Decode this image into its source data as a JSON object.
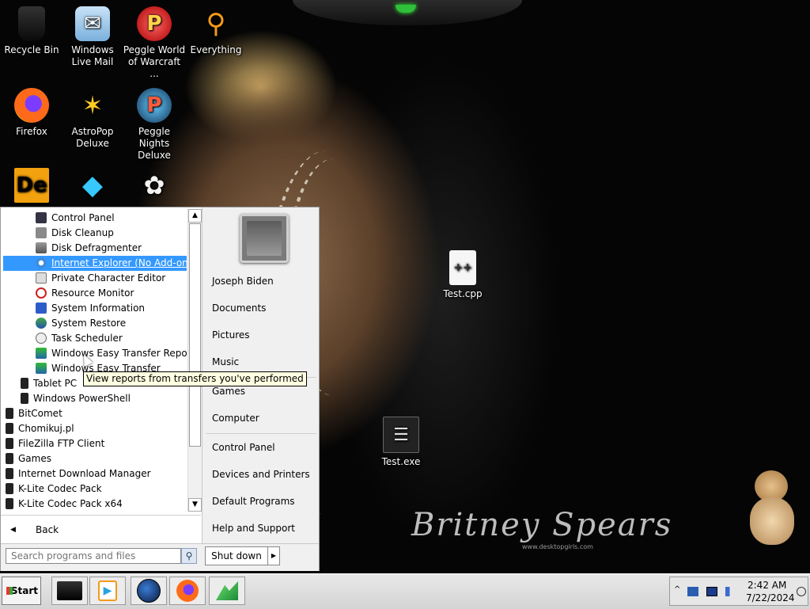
{
  "desktop": {
    "icons": [
      {
        "label": "Recycle Bin"
      },
      {
        "label": "Windows Live Mail"
      },
      {
        "label": "Peggle World of Warcraft ..."
      },
      {
        "label": "Everything"
      },
      {
        "label": "Firefox"
      },
      {
        "label": "AstroPop Deluxe"
      },
      {
        "label": "Peggle Nights Deluxe"
      },
      {
        "label": "Test.cpp"
      },
      {
        "label": "Test.exe"
      }
    ],
    "signature": "Britney Spears",
    "signature_sub": "www.desktopgirls.com"
  },
  "start_menu": {
    "programs": [
      {
        "label": "Control Panel",
        "icon": "monitor-icon"
      },
      {
        "label": "Disk Cleanup",
        "icon": "disk-cleanup-icon"
      },
      {
        "label": "Disk Defragmenter",
        "icon": "defrag-icon"
      },
      {
        "label": "Internet Explorer (No Add-ons)",
        "icon": "ie-icon",
        "selected": true
      },
      {
        "label": "Private Character Editor",
        "icon": "pencil-icon"
      },
      {
        "label": "Resource Monitor",
        "icon": "resource-monitor-icon"
      },
      {
        "label": "System Information",
        "icon": "info-icon"
      },
      {
        "label": "System Restore",
        "icon": "restore-icon"
      },
      {
        "label": "Task Scheduler",
        "icon": "clock-icon"
      },
      {
        "label": "Windows Easy Transfer Reports",
        "icon": "transfer-icon"
      },
      {
        "label": "Windows Easy Transfer",
        "icon": "transfer-icon"
      },
      {
        "label": "Tablet PC",
        "icon": "folder-icon"
      },
      {
        "label": "Windows PowerShell",
        "icon": "folder-icon"
      },
      {
        "label": "BitComet",
        "icon": "folder-icon"
      },
      {
        "label": "Chomikuj.pl",
        "icon": "folder-icon"
      },
      {
        "label": "FileZilla FTP Client",
        "icon": "folder-icon"
      },
      {
        "label": "Games",
        "icon": "folder-icon"
      },
      {
        "label": "Internet Download Manager",
        "icon": "folder-icon"
      },
      {
        "label": "K-Lite Codec Pack",
        "icon": "folder-icon"
      },
      {
        "label": "K-Lite Codec Pack x64",
        "icon": "folder-icon"
      }
    ],
    "back_label": "Back",
    "search_placeholder": "Search programs and files",
    "shutdown_label": "Shut down",
    "right_items": {
      "user": "Joseph Biden",
      "documents": "Documents",
      "pictures": "Pictures",
      "music": "Music",
      "games": "Games",
      "computer": "Computer",
      "control_panel": "Control Panel",
      "devices": "Devices and Printers",
      "default_programs": "Default Programs",
      "help": "Help and Support"
    }
  },
  "tooltip": "View reports from transfers you've performed",
  "taskbar": {
    "start_label": "Start",
    "clock_time": "2:42 AM",
    "clock_date": "7/22/2024"
  },
  "colors": {
    "selection": "#3399ff",
    "tooltip_bg": "#ffffe1",
    "taskbar": "#d4d4d4"
  }
}
